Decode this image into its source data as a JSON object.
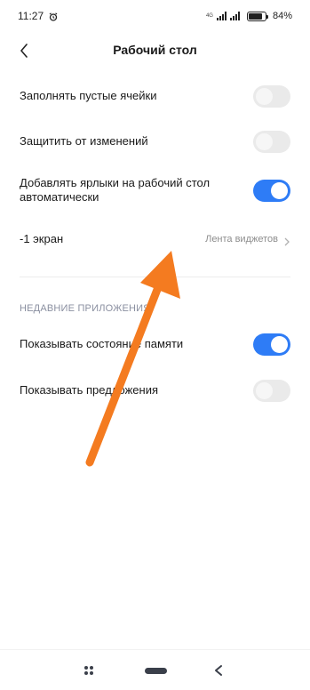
{
  "status_bar": {
    "time": "11:27",
    "network": "4G",
    "battery_percent": "84%"
  },
  "header": {
    "title": "Рабочий стол"
  },
  "settings": [
    {
      "label": "Заполнять пустые ячейки",
      "toggle": "off"
    },
    {
      "label": "Защитить от изменений",
      "toggle": "off"
    },
    {
      "label": "Добавлять ярлыки на рабочий стол автоматически",
      "toggle": "on"
    }
  ],
  "minus_one_screen": {
    "label": "-1 экран",
    "value": "Лента виджетов"
  },
  "recent_apps": {
    "section_title": "НЕДАВНИЕ ПРИЛОЖЕНИЯ",
    "items": [
      {
        "label": "Показывать состояние памяти",
        "toggle": "on"
      },
      {
        "label": "Показывать предложения",
        "toggle": "off"
      }
    ]
  },
  "colors": {
    "accent": "#2e7cf6",
    "annotation_arrow": "#f47b20"
  }
}
